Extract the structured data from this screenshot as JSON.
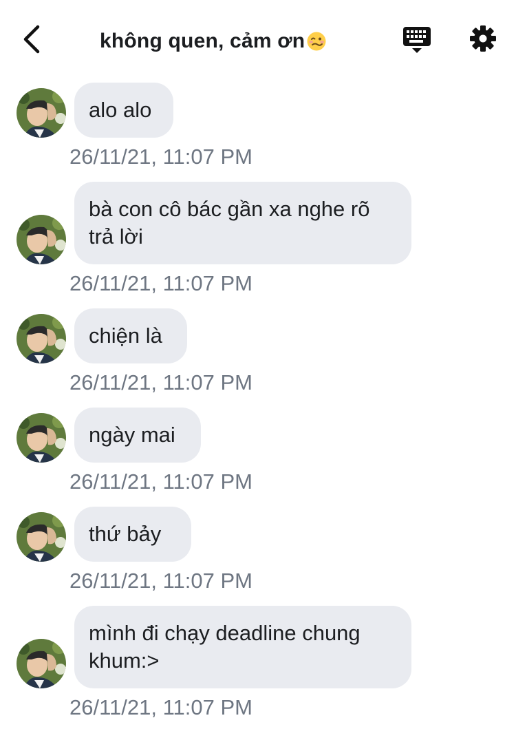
{
  "header": {
    "title": "không quen, cảm ơn",
    "title_emoji": "woozy-face-emoji",
    "back_icon": "chevron-left-icon",
    "keyboard_icon": "keyboard-icon",
    "settings_icon": "gear-icon"
  },
  "messages": [
    {
      "text": "alo alo",
      "timestamp": "26/11/21, 11:07 PM"
    },
    {
      "text": "bà con cô bác gần xa nghe rõ trả lời",
      "timestamp": "26/11/21, 11:07 PM"
    },
    {
      "text": "chiện là",
      "timestamp": "26/11/21, 11:07 PM"
    },
    {
      "text": "ngày mai",
      "timestamp": "26/11/21, 11:07 PM"
    },
    {
      "text": "thứ bảy",
      "timestamp": "26/11/21, 11:07 PM"
    },
    {
      "text": "mình đi chạy deadline chung khum:>",
      "timestamp": "26/11/21, 11:07 PM"
    }
  ],
  "colors": {
    "bubble": "#e9ebf0",
    "timestamp": "#6e7682",
    "text": "#1c1e21"
  }
}
